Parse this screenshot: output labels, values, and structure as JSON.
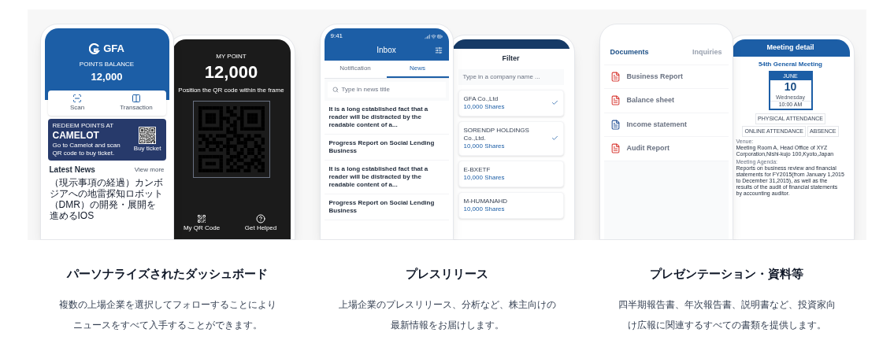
{
  "features": [
    {
      "kind": "dashboard",
      "title": "パーソナライズされたダッシュボード",
      "description": "複数の上場企業を選択してフォローすることによりニュースをすべて入手することができます。",
      "mockup": {
        "front": {
          "logo": "GFA",
          "balance_label": "POINTS BALANCE",
          "balance": "12,000",
          "actions": [
            "Scan",
            "Transaction"
          ],
          "banner": {
            "kicker": "REDEEM POINTS AT",
            "title": "CAMELOT",
            "text": "Go to Camelot and scan QR code to buy ticket.",
            "button": "Buy ticket"
          },
          "news_heading": "Latest News",
          "view_more": "View more",
          "news": [
            "（現示事項の経過）カンボジアへの地雷探知ロボット（DMR）の開発・展開を進めるIOS"
          ]
        },
        "back": {
          "label": "MY POINT",
          "value": "12,000",
          "hint": "Position the QR code within the frame",
          "buttons": [
            "My QR Code",
            "Get Helped"
          ]
        }
      }
    },
    {
      "kind": "inbox",
      "title": "プレスリリース",
      "description": "上場企業のプレスリリース、分析など、株主向けの最新情報をお届けします。",
      "mockup": {
        "front": {
          "time": "9:41",
          "title": "Inbox",
          "tabs": [
            {
              "label": "Notification",
              "selected": false
            },
            {
              "label": "News",
              "selected": true
            }
          ],
          "search_placeholder": "Type in news title",
          "items": [
            "It is a long established fact that a reader will be distracted by the readable content of a...",
            "Progress Report on Social Lending Business",
            "It is a long established fact that a reader will be distracted by the readable content of a...",
            "Progress Report on Social Lending Business"
          ]
        },
        "back": {
          "title": "Filter",
          "search_placeholder": "Type in a company name ...",
          "companies": [
            {
              "name": "GFA Co.,Ltd",
              "shares": "10,000 Shares",
              "checked": true
            },
            {
              "name": "SORENDP HOLDINGS Co.,Ltd.",
              "shares": "10,000 Shares",
              "checked": true
            },
            {
              "name": "E-BXETF",
              "shares": "10,000 Shares",
              "checked": false
            },
            {
              "name": "M-HUMANAHD",
              "shares": "10,000 Shares",
              "checked": false
            }
          ]
        }
      }
    },
    {
      "kind": "documents",
      "title": "プレゼンテーション・資料等",
      "description": "四半期報告書、年次報告書、説明書など、投資家向け広報に関連するすべての書類を提供します。",
      "mockup": {
        "front": {
          "tabs": [
            {
              "label": "Documents",
              "selected": true
            },
            {
              "label": "Inquiries",
              "selected": false
            }
          ],
          "documents": [
            {
              "kind": "pdf",
              "name": "Business Report"
            },
            {
              "kind": "pdf",
              "name": "Balance sheet"
            },
            {
              "kind": "word",
              "name": "Income statement"
            },
            {
              "kind": "pdf",
              "name": "Audit Report"
            }
          ]
        },
        "back": {
          "title": "Meeting detail",
          "meeting": "54th General Meeting",
          "month": "JUNE",
          "day": "10",
          "weekday": "Wednesday",
          "time": "10:00 AM",
          "options": [
            "PHYSICAL ATTENDANCE",
            "ONLINE ATTENDANCE",
            "ABSENCE"
          ],
          "venue_label": "Venue:",
          "venue": "Meeting Room A, Head Office of XYZ Corporation,Nishi-kujo 100,Kyoto,Japan",
          "agenda_label": "Meeting Agenda:",
          "agenda": "Reports on business review and financial statements for FY2015(from January 1,2015 to December 31,2015), as well as the results of the audit of financial statements by accounting auditor."
        }
      }
    }
  ]
}
